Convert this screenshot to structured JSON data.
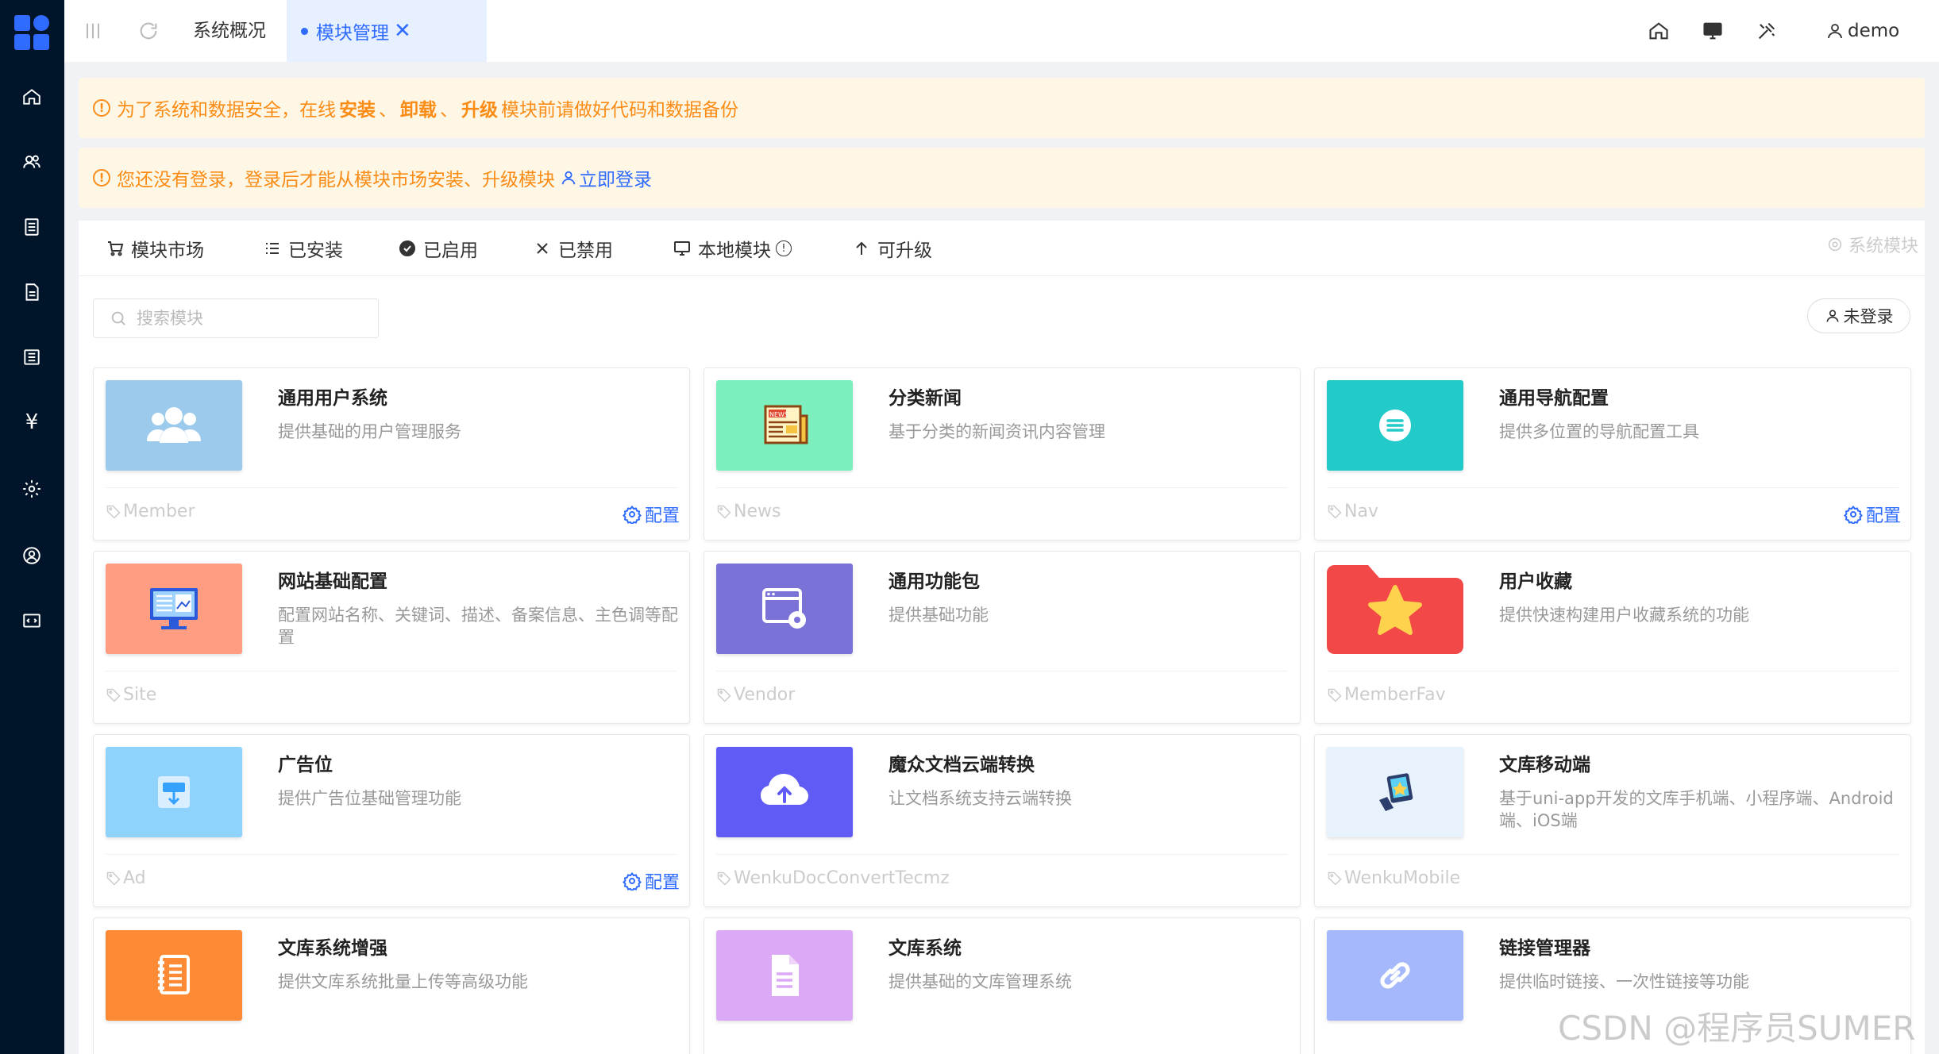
{
  "topbar": {
    "tab_overview": "系统概况",
    "tab_active": "模块管理",
    "tab_close": "✕",
    "username": "demo"
  },
  "notices": {
    "security_prefix": "为了系统和数据安全，在线",
    "security_install": "安装",
    "security_sep1": "、",
    "security_uninstall": "卸载",
    "security_sep2": "、",
    "security_upgrade": "升级",
    "security_suffix": "模块前请做好代码和数据备份",
    "login_text": "您还没有登录，登录后才能从模块市场安装、升级模块",
    "login_link": "立即登录"
  },
  "module_tabs": {
    "market": "模块市场",
    "installed": "已安装",
    "enabled": "已启用",
    "disabled": "已禁用",
    "local": "本地模块",
    "upgradable": "可升级",
    "system_modules": "系统模块"
  },
  "search": {
    "placeholder": "搜索模块"
  },
  "login_status": "未登录",
  "config_label": "配置",
  "modules": [
    {
      "title": "通用用户系统",
      "desc": "提供基础的用户管理服务",
      "tag": "Member",
      "thumb_color": "#9ccaec",
      "icon": "users-icon",
      "configurable": true
    },
    {
      "title": "分类新闻",
      "desc": "基于分类的新闻资讯内容管理",
      "tag": "News",
      "thumb_color": "#7defbf",
      "icon": "newspaper-icon",
      "configurable": false
    },
    {
      "title": "通用导航配置",
      "desc": "提供多位置的导航配置工具",
      "tag": "Nav",
      "thumb_color": "#22cbc9",
      "icon": "menu-circle-icon",
      "configurable": true
    },
    {
      "title": "网站基础配置",
      "desc": "配置网站名称、关键词、描述、备案信息、主色调等配置",
      "tag": "Site",
      "thumb_color": "#ff9d82",
      "icon": "monitor-icon",
      "configurable": false
    },
    {
      "title": "通用功能包",
      "desc": "提供基础功能",
      "tag": "Vendor",
      "thumb_color": "#7a72d6",
      "icon": "window-gear-icon",
      "configurable": false
    },
    {
      "title": "用户收藏",
      "desc": "提供快速构建用户收藏系统的功能",
      "tag": "MemberFav",
      "thumb_color": "#ffffff",
      "icon": "star-folder-icon",
      "configurable": false
    },
    {
      "title": "广告位",
      "desc": "提供广告位基础管理功能",
      "tag": "Ad",
      "thumb_color": "#8ed3fb",
      "icon": "ad-board-icon",
      "configurable": true
    },
    {
      "title": "魔众文档云端转换",
      "desc": "让文档系统支持云端转换",
      "tag": "WenkuDocConvertTecmz",
      "thumb_color": "#5f5bf4",
      "icon": "cloud-upload-icon",
      "configurable": false
    },
    {
      "title": "文库移动端",
      "desc": "基于uni-app开发的文库手机端、小程序端、Android端、iOS端",
      "tag": "WenkuMobile",
      "thumb_color": "#e8f2fd",
      "icon": "mobile-badge-icon",
      "configurable": false
    },
    {
      "title": "文库系统增强",
      "desc": "提供文库系统批量上传等高级功能",
      "tag": "",
      "thumb_color": "#ff8a36",
      "icon": "notebook-icon",
      "configurable": false
    },
    {
      "title": "文库系统",
      "desc": "提供基础的文库管理系统",
      "tag": "",
      "thumb_color": "#dca9f7",
      "icon": "document-icon",
      "configurable": false
    },
    {
      "title": "链接管理器",
      "desc": "提供临时链接、一次性链接等功能",
      "tag": "",
      "thumb_color": "#a5b8fb",
      "icon": "link-icon",
      "configurable": false
    }
  ],
  "watermark": "CSDN @程序员SUMER"
}
